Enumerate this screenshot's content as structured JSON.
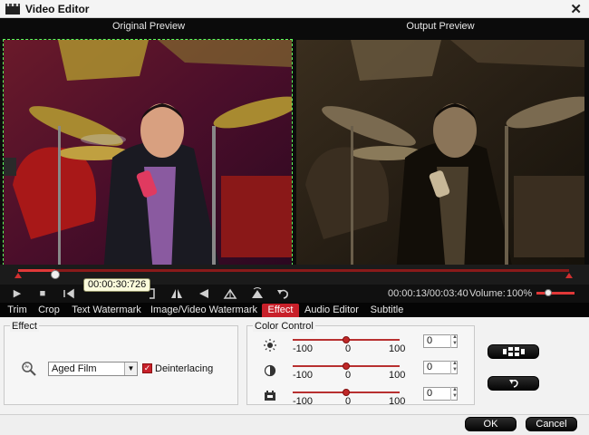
{
  "window": {
    "title": "Video Editor",
    "close_glyph": "✕"
  },
  "preview": {
    "original_label": "Original Preview",
    "output_label": "Output Preview"
  },
  "timeline": {
    "progress": 0.067,
    "tooltip_time": "00:00:30:726"
  },
  "controls": {
    "play_glyph": "▶",
    "stop_glyph": "■",
    "time_readout": "00:00:13/00:03:40",
    "volume_label": "Volume:",
    "volume_value": "100%",
    "volume_level": 1.0,
    "icons": [
      "play-icon",
      "stop-icon",
      "prev-frame-icon",
      "next-frame-icon",
      "mark-in-icon",
      "mark-out-icon",
      "flip-vertical-icon",
      "flip-left-icon",
      "rotate-left-icon",
      "rotate-right-icon",
      "undo-icon"
    ]
  },
  "tabs": [
    {
      "label": "Trim",
      "active": false
    },
    {
      "label": "Crop",
      "active": false
    },
    {
      "label": "Text Watermark",
      "active": false
    },
    {
      "label": "Image/Video Watermark",
      "active": false
    },
    {
      "label": "Effect",
      "active": true
    },
    {
      "label": "Audio Editor",
      "active": false
    },
    {
      "label": "Subtitle",
      "active": false
    }
  ],
  "effect": {
    "group_title": "Effect",
    "selected": "Aged Film",
    "deinterlacing_label": "Deinterlacing",
    "deinterlacing_checked": true,
    "check_glyph": "✓"
  },
  "color_control": {
    "group_title": "Color Control",
    "rows": [
      {
        "icon": "brightness-icon",
        "min": "-100",
        "mid": "0",
        "max": "100",
        "value": "0",
        "level": 0.5
      },
      {
        "icon": "contrast-icon",
        "min": "-100",
        "mid": "0",
        "max": "100",
        "value": "0",
        "level": 0.5
      },
      {
        "icon": "saturation-icon",
        "min": "-100",
        "mid": "0",
        "max": "100",
        "value": "0",
        "level": 0.5
      }
    ]
  },
  "buttons": {
    "ok": "OK",
    "cancel": "Cancel"
  },
  "colors": {
    "accent": "#c8202a",
    "preview_border": "#5cff5c",
    "panel_bg": "#f2f2f2"
  }
}
